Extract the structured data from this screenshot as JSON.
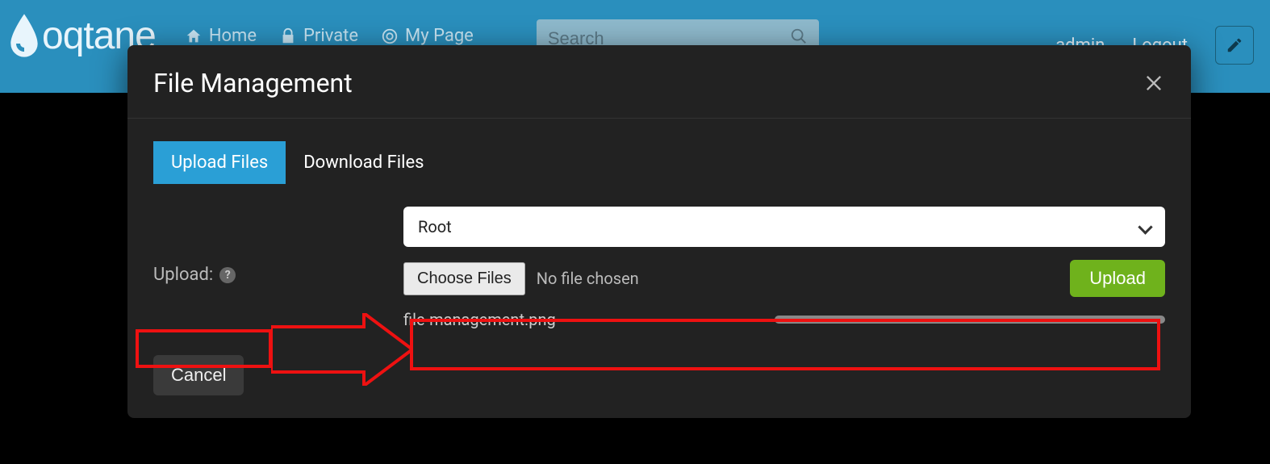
{
  "header": {
    "brand": "oqtane",
    "nav": [
      {
        "icon": "home-icon",
        "label": "Home"
      },
      {
        "icon": "lock-icon",
        "label": "Private"
      },
      {
        "icon": "target-icon",
        "label": "My Page"
      }
    ],
    "search_placeholder": "Search",
    "user": "admin",
    "logout": "Logout"
  },
  "modal": {
    "title": "File Management",
    "tabs": [
      {
        "label": "Upload Files",
        "active": true
      },
      {
        "label": "Download Files",
        "active": false
      }
    ],
    "upload_label": "Upload:",
    "folder_selected": "Root",
    "choose_files_label": "Choose Files",
    "no_file_text": "No file chosen",
    "upload_button": "Upload",
    "file_in_progress": "file-management.png",
    "cancel_button": "Cancel"
  }
}
